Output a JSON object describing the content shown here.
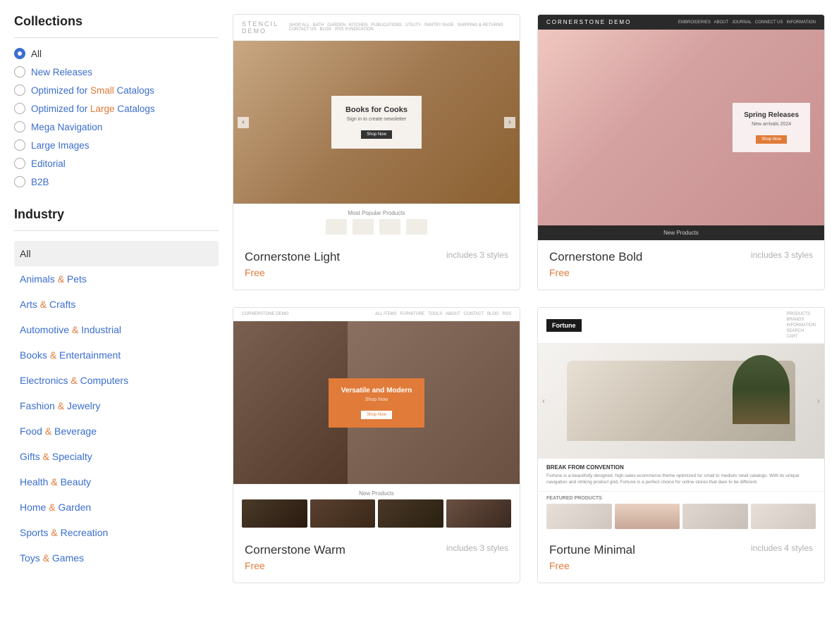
{
  "sidebar": {
    "collections_title": "Collections",
    "collections": [
      {
        "id": "all",
        "label": "All",
        "active": true
      },
      {
        "id": "new-releases",
        "label": "New Releases",
        "active": false
      },
      {
        "id": "small-catalogs",
        "label": "Optimized for Small Catalogs",
        "active": false,
        "highlight": "Small"
      },
      {
        "id": "large-catalogs",
        "label": "Optimized for Large Catalogs",
        "active": false,
        "highlight": "Large"
      },
      {
        "id": "mega-navigation",
        "label": "Mega Navigation",
        "active": false
      },
      {
        "id": "large-images",
        "label": "Large Images",
        "active": false
      },
      {
        "id": "editorial",
        "label": "Editorial",
        "active": false
      },
      {
        "id": "b2b",
        "label": "B2B",
        "active": false
      }
    ],
    "industry_title": "Industry",
    "industry_items": [
      {
        "id": "all",
        "label": "All",
        "selected": true
      },
      {
        "id": "animals",
        "label": "Animals & Pets",
        "amp": "&"
      },
      {
        "id": "arts",
        "label": "Arts & Crafts",
        "amp": "&"
      },
      {
        "id": "automotive",
        "label": "Automotive & Industrial",
        "amp": "&"
      },
      {
        "id": "books",
        "label": "Books & Entertainment",
        "amp": "&"
      },
      {
        "id": "electronics",
        "label": "Electronics & Computers",
        "amp": "&"
      },
      {
        "id": "fashion",
        "label": "Fashion & Jewelry",
        "amp": "&"
      },
      {
        "id": "food",
        "label": "Food & Beverage",
        "amp": "&"
      },
      {
        "id": "gifts",
        "label": "Gifts & Specialty",
        "amp": "&"
      },
      {
        "id": "health",
        "label": "Health & Beauty",
        "amp": "&"
      },
      {
        "id": "home",
        "label": "Home & Garden",
        "amp": "&"
      },
      {
        "id": "sports",
        "label": "Sports & Recreation",
        "amp": "&"
      },
      {
        "id": "toys",
        "label": "Toys & Games",
        "amp": "&"
      }
    ]
  },
  "themes": [
    {
      "id": "cornerstone-light",
      "name": "Cornerstone Light",
      "styles": "includes 3 styles",
      "price": "Free",
      "preview_type": "stencil",
      "nav_logo": "STENCIL DEMO",
      "nav_links": [
        "SHOP ALL",
        "BATH",
        "GARDEN",
        "KITCHEN",
        "PUBLICATIONS",
        "UTILITY",
        "PANTRY PAGE",
        "SHIPPING & RETURNS",
        "CONTACT US",
        "BLOG",
        "RSS SYNDICATION"
      ],
      "hero_title": "Books for Cooks",
      "hero_subtitle": "Sign in to create newsletter",
      "hero_btn": "Shop Now"
    },
    {
      "id": "cornerstone-bold",
      "name": "Cornerstone Bold",
      "styles": "includes 3 styles",
      "price": "Free",
      "preview_type": "bold",
      "nav_logo": "CORNERSTONE DEMO",
      "hero_title": "Spring Releases",
      "hero_btn": "Shop Now",
      "bottom_label": "New Products"
    },
    {
      "id": "cornerstone-warm",
      "name": "Cornerstone Warm",
      "styles": "includes 3 styles",
      "price": "Free",
      "preview_type": "warm",
      "nav_logo": "CORNERSTONE DEMO",
      "hero_title": "Versatile and Modern",
      "bottom_label": "New Products"
    },
    {
      "id": "fortune-minimal",
      "name": "Fortune Minimal",
      "styles": "includes 4 styles",
      "price": "Free",
      "preview_type": "fortune",
      "nav_logo": "Fortune",
      "hero_title": "BREAK FROM CONVENTION",
      "hero_desc": "Fortune is a beautifully designed, high-sales ecommerce theme optimized for small to medium retail catalogs. With its unique navigation and striking product grid, Fortune is a perfect choice for online stores that dare to be different.",
      "featured_label": "FEATURED PRODUCTS"
    }
  ]
}
